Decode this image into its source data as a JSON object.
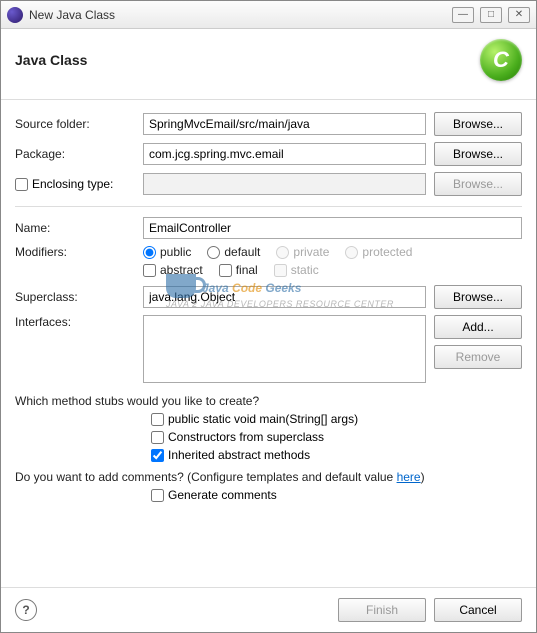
{
  "window": {
    "title": "New Java Class"
  },
  "header": {
    "title": "Java Class",
    "icon_letter": "C"
  },
  "fields": {
    "source_folder": {
      "label": "Source folder:",
      "value": "SpringMvcEmail/src/main/java",
      "browse": "Browse..."
    },
    "package": {
      "label": "Package:",
      "value": "com.jcg.spring.mvc.email",
      "browse": "Browse..."
    },
    "enclosing": {
      "label": "Enclosing type:",
      "value": "",
      "browse": "Browse..."
    },
    "name": {
      "label": "Name:",
      "value": "EmailController"
    },
    "superclass": {
      "label": "Superclass:",
      "value": "java.lang.Object",
      "browse": "Browse..."
    },
    "interfaces": {
      "label": "Interfaces:",
      "add": "Add...",
      "remove": "Remove"
    }
  },
  "modifiers": {
    "label": "Modifiers:",
    "visibility": {
      "public": "public",
      "default": "default",
      "private": "private",
      "protected": "protected"
    },
    "flags": {
      "abstract": "abstract",
      "final": "final",
      "static": "static"
    }
  },
  "stubs": {
    "question": "Which method stubs would you like to create?",
    "main": "public static void main(String[] args)",
    "ctors": "Constructors from superclass",
    "inherited": "Inherited abstract methods"
  },
  "comments": {
    "question_pre": "Do you want to add comments? (Configure templates and default value ",
    "link": "here",
    "question_post": ")",
    "generate": "Generate comments"
  },
  "footer": {
    "finish": "Finish",
    "cancel": "Cancel"
  },
  "watermark": {
    "line1a": "Java ",
    "line1b": "Code ",
    "line1c": "Geeks",
    "line2": "JAVA 2 JAVA DEVELOPERS RESOURCE CENTER"
  }
}
